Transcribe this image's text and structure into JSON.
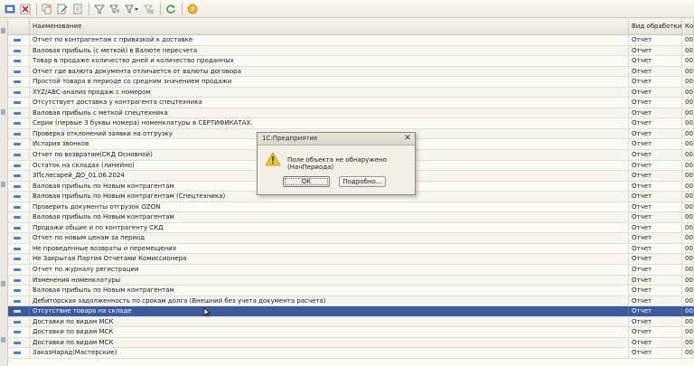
{
  "toolbar": {
    "icons": [
      "open-icon",
      "delete-icon",
      "copy-icon",
      "edit-icon",
      "new-icon",
      "filter-icon",
      "filter-list-icon",
      "filter-dropdown-icon",
      "clear-filter-icon",
      "refresh-icon",
      "help-icon"
    ]
  },
  "table": {
    "columns": [
      "",
      "Наименование",
      "Вид обработки",
      "Ко"
    ],
    "rows": [
      {
        "name": "Отчет по контрагентам с привязкой к доставке",
        "type": "Отчет",
        "code": "00"
      },
      {
        "name": "Валовая прибыль (с меткой) в Валюте пересчета",
        "type": "Отчет",
        "code": "00"
      },
      {
        "name": "Товар в продаже количество дней и количество проданных",
        "type": "Отчет",
        "code": "00"
      },
      {
        "name": "Отчет где валюта документа отличается от валюты договора",
        "type": "Отчет",
        "code": "00"
      },
      {
        "name": "Простой товара в периоде со средним значением продажи",
        "type": "Отчет",
        "code": "00"
      },
      {
        "name": "XYZ/ABC-анализ продаж с номером",
        "type": "Отчет",
        "code": "00"
      },
      {
        "name": "Отсутствует доставка у контрагента спецтехника",
        "type": "Отчет",
        "code": "00"
      },
      {
        "name": "Валовая прибыль с меткой спецтехника",
        "type": "Отчет",
        "code": "00"
      },
      {
        "name": "Серии (первые 3 буквы номера) номенклатуры в СЕРТИФИКАТАХ.",
        "type": "Отчет",
        "code": "00"
      },
      {
        "name": "Проверка отклонений заявки на отгрузку",
        "type": "Отчет",
        "code": "00"
      },
      {
        "name": "История звонков",
        "type": "Отчет",
        "code": "00"
      },
      {
        "name": "Отчет по возвратам(СКД Основной)",
        "type": "Отчет",
        "code": "00"
      },
      {
        "name": "Остаток на складах (линейно)",
        "type": "Отчет",
        "code": "00"
      },
      {
        "name": "ЗПслесарей_ДО_01.06.2024",
        "type": "Отчет",
        "code": "00"
      },
      {
        "name": "Валовая прибыль по Новым контрагентам",
        "type": "Отчет",
        "code": "00"
      },
      {
        "name": "Валовая прибыль по Новым контрагентам (Спецтехника)",
        "type": "Отчет",
        "code": "00"
      },
      {
        "name": "Проверить документы отгрузок OZON",
        "type": "Отчет",
        "code": "00"
      },
      {
        "name": "Валовая прибыль по Новым контрагентам",
        "type": "Отчет",
        "code": "00"
      },
      {
        "name": "Продажи общие и по контрагенту СКД",
        "type": "Отчет",
        "code": "00"
      },
      {
        "name": "Отчет по новым ценам за период",
        "type": "Отчет",
        "code": "00"
      },
      {
        "name": "Не проведенные возвраты и перемещения",
        "type": "Отчет",
        "code": "00"
      },
      {
        "name": "Не Закрытая Партия Отчетами Комиссионера",
        "type": "Отчет",
        "code": "00"
      },
      {
        "name": "Отчет по журналу регистрации",
        "type": "Отчет",
        "code": "00"
      },
      {
        "name": "Изменения номенклатуры",
        "type": "Отчет",
        "code": "00"
      },
      {
        "name": "Валовая прибыль по Новым контрагентам",
        "type": "Отчет",
        "code": "00"
      },
      {
        "name": "Дебиторская задолженность по срокам долга (Внешний без учета документа расчета)",
        "type": "Отчет",
        "code": "00"
      },
      {
        "name": "Отсутствие товара на складе",
        "type": "Отчет",
        "code": "00",
        "selected": true
      },
      {
        "name": "Доставки по видам МСК",
        "type": "Отчет",
        "code": "00"
      },
      {
        "name": "Доставки по видам МСК",
        "type": "Отчет",
        "code": "00"
      },
      {
        "name": "Доставки по видам МСК",
        "type": "Отчет",
        "code": "00"
      },
      {
        "name": "ЗаказНаряд(Мастерские)",
        "type": "Отчет",
        "code": "00"
      }
    ]
  },
  "dialog": {
    "title": "1С:Предприятие",
    "close": "✕",
    "message": "Поле объекта не обнаружено (НачПериода)",
    "ok_label": "ОК",
    "details_label": "Подробно..."
  }
}
